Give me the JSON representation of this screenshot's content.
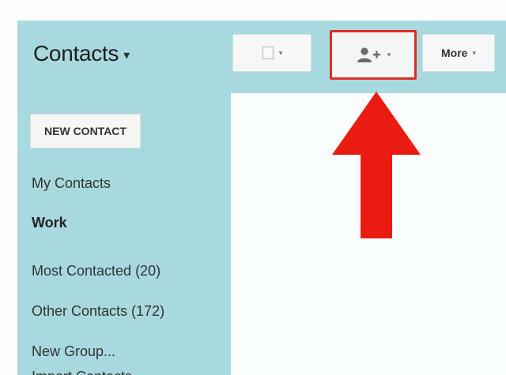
{
  "header": {
    "title": "Contacts",
    "title_caret": "▾"
  },
  "toolbar": {
    "select_dropdown": "▾",
    "add_people_dropdown": "▾",
    "more_label": "More",
    "more_dropdown": "▾"
  },
  "sidebar": {
    "new_contact": "NEW CONTACT",
    "items": [
      {
        "label": "My Contacts",
        "bold": false
      },
      {
        "label": "Work",
        "bold": true
      },
      {
        "label": "Most Contacted (20)",
        "bold": false
      },
      {
        "label": "Other Contacts (172)",
        "bold": false
      },
      {
        "label": "New Group...",
        "bold": false
      },
      {
        "label": "Import Contacts...",
        "bold": false
      }
    ]
  },
  "icons": {
    "select": "checkbox-icon",
    "add_people": "add-person-icon",
    "annotation": "red-arrow-icon"
  },
  "colors": {
    "frame": "#a7d9df",
    "content": "#f9fdfe",
    "highlight": "#e32b25",
    "arrow": "#ea1c12"
  }
}
